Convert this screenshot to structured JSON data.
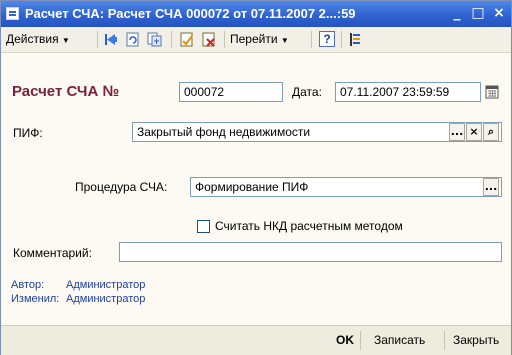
{
  "window": {
    "title": "Расчет СЧА: Расчет СЧА 000072 от 07.11.2007 2...:59",
    "minimize_label": "_",
    "maximize_label": "□",
    "close_label": "×"
  },
  "toolbar": {
    "actions_label": "Действия",
    "goto_label": "Перейти",
    "help_label": "?",
    "icons": [
      "arrow-left-blue-icon",
      "refresh-doc-icon",
      "copy-doc-icon",
      "post-doc-icon",
      "unpost-doc-icon",
      "help-icon",
      "structure-icon"
    ]
  },
  "header": {
    "doc_label": "Расчет СЧА №",
    "doc_number": "000072",
    "date_label": "Дата:",
    "date_value": "07.11.2007 23:59:59"
  },
  "form": {
    "pif_label": "ПИФ:",
    "pif_value": "Закрытый фонд недвижимости",
    "procedure_label": "Процедура СЧА:",
    "procedure_value": "Формирование ПИФ",
    "nkd_label": "Считать НКД расчетным методом",
    "nkd_checked": false,
    "comment_label": "Комментарий:",
    "comment_value": ""
  },
  "footer_info": {
    "author_label": "Автор:",
    "author_value": "Администратор",
    "changed_label": "Изменил:",
    "changed_value": "Администратор"
  },
  "buttons": {
    "ok_label": "OK",
    "save_label": "Записать",
    "close_label": "Закрыть"
  },
  "colors": {
    "titlebar": "#2f63cf",
    "doc_label": "#7a1f3d",
    "info_text": "#1f3fa0"
  }
}
